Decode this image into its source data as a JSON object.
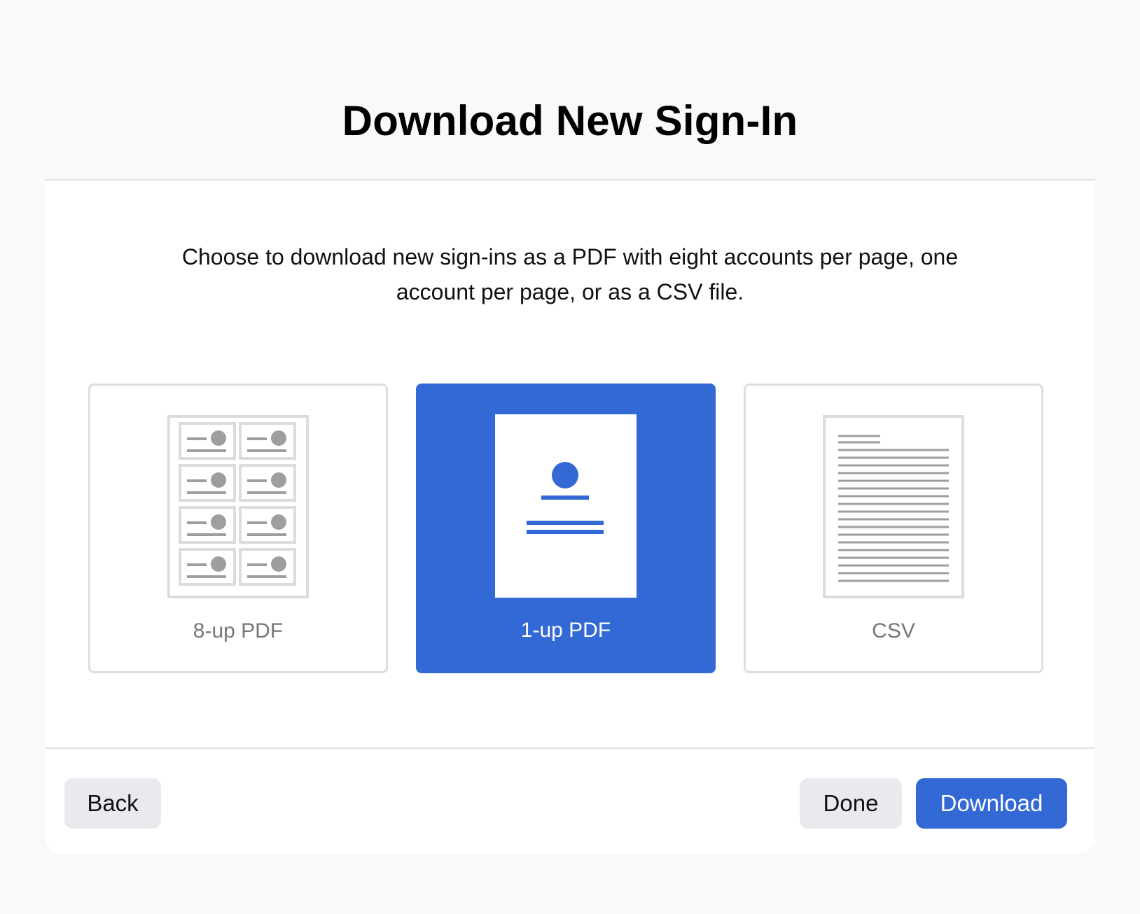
{
  "dialog": {
    "title": "Download New Sign-In",
    "description": "Choose to download new sign-ins as a PDF with eight accounts per page, one account per page, or as a CSV file."
  },
  "options": [
    {
      "label": "8-up PDF",
      "icon": "8-up-pdf-icon",
      "selected": false
    },
    {
      "label": "1-up PDF",
      "icon": "1-up-pdf-icon",
      "selected": true
    },
    {
      "label": "CSV",
      "icon": "csv-file-icon",
      "selected": false
    }
  ],
  "footer": {
    "back_label": "Back",
    "done_label": "Done",
    "download_label": "Download"
  },
  "colors": {
    "accent": "#3269d4",
    "secondary_button": "#e9e9ee",
    "border": "#dedede",
    "icon_gray": "#9e9e9e"
  }
}
